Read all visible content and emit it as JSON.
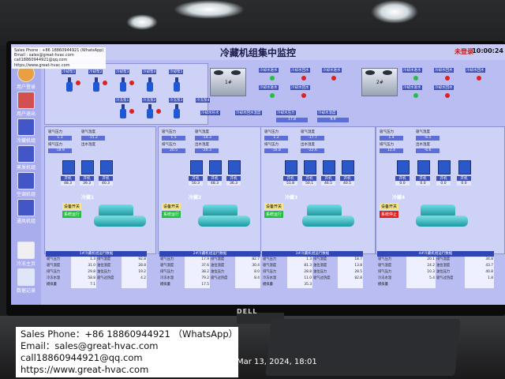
{
  "screen": {
    "title": "冷藏机组集中监控",
    "login_status": "未登录",
    "time": "10:00:24"
  },
  "sidebar": [
    {
      "label": "用户登录"
    },
    {
      "label": "用户退出"
    },
    {
      "label": "冷藏机组"
    },
    {
      "label": "蒸发机组"
    },
    {
      "label": "空调机组"
    },
    {
      "label": "通风机组"
    },
    {
      "label": "冷冻主页"
    },
    {
      "label": "数据记录"
    }
  ],
  "pumps": {
    "labels": [
      "冷却泵1",
      "冷却泵2",
      "冷却泵3",
      "冷却泵4",
      "冷却泵5"
    ],
    "labels2": [
      "冷冻泵1",
      "冷冻泵2",
      "冷冻泵3",
      "冷冻泵4"
    ]
  },
  "towers": [
    {
      "label": "1#"
    },
    {
      "label": "2#"
    }
  ],
  "tower_status": [
    [
      "冷却水进水",
      "冷却水回水"
    ],
    [
      "冷却水进水",
      "冷却水回水"
    ],
    [
      "冷却水进水",
      "冷却水回水"
    ]
  ],
  "system": {
    "items": [
      {
        "label": "冷却水补水",
        "value": "1.2"
      },
      {
        "label": "冷却水回水温度",
        "value": ""
      },
      {
        "label": "冷却水压力",
        "value": "17.8"
      },
      {
        "label": "冷却水温度",
        "value": "9.9"
      }
    ]
  },
  "units": [
    {
      "name": "冷藏1",
      "status_label": "设备开关",
      "status_text": "系统运行",
      "status_color": "#22c040",
      "params": [
        [
          "吸气压力",
          "1.3"
        ],
        [
          "吸气温度",
          "-15.2"
        ],
        [
          "排气压力",
          "-18.9"
        ],
        [
          "出水温度",
          ""
        ]
      ],
      "compressors": [
        "开机",
        "开机",
        "开机"
      ],
      "rt": [
        [
          "开机",
          "48.3"
        ],
        [
          "开机",
          "39.3"
        ],
        [
          "开机",
          "40.3"
        ]
      ]
    },
    {
      "name": "冷藏2",
      "status_label": "设备开关",
      "status_text": "系统运行",
      "status_color": "#22c040",
      "params": [
        [
          "吸气压力",
          "1.5"
        ],
        [
          "吸气温度",
          "-14.3"
        ],
        [
          "排气压力",
          "20.5"
        ],
        [
          "出水温度",
          "-20.3"
        ]
      ],
      "compressors": [
        "开机",
        "开机",
        "开机"
      ],
      "rt": [
        [
          "开机",
          "50.3"
        ],
        [
          "开机",
          "48.3"
        ],
        [
          "开机",
          "36.3"
        ]
      ]
    },
    {
      "name": "冷藏3",
      "status_label": "设备开关",
      "status_text": "系统运行",
      "status_color": "#22c040",
      "params": [
        [
          "吸气压力",
          "1.2"
        ],
        [
          "吸气温度",
          "-17.7"
        ],
        [
          "排气压力",
          "-16.8"
        ],
        [
          "出水温度",
          "-22.6"
        ]
      ],
      "compressors": [
        "开机",
        "开机",
        "开机",
        "开机"
      ],
      "rt": [
        [
          "开机",
          "51.8"
        ],
        [
          "开机",
          "50.1"
        ],
        [
          "开机",
          "46.5"
        ],
        [
          "开机",
          "40.5"
        ]
      ]
    },
    {
      "name": "冷藏4",
      "status_label": "设备开关",
      "status_text": "系统停止",
      "status_color": "#e02020",
      "params": [
        [
          "吸气压力",
          "1.4"
        ],
        [
          "吸气温度",
          "-6.5"
        ],
        [
          "排气压力",
          "12.4"
        ],
        [
          "出水温度",
          "-6.6"
        ]
      ],
      "compressors": [
        "关机",
        "关机",
        "关机",
        "关机"
      ],
      "rt": [
        [
          "开机",
          "0.0"
        ],
        [
          "开机",
          "0.0"
        ],
        [
          "开机",
          "0.0"
        ],
        [
          "开机",
          "0.0"
        ]
      ]
    }
  ],
  "tables": [
    {
      "title": "1#冷藏机组运行数据",
      "rows": [
        [
          "吸气压力",
          "1.3",
          "排气温度",
          "92.8"
        ],
        [
          "吸气温度",
          "31.0",
          "油位温度",
          "28.8"
        ],
        [
          "排气压力",
          "29.8",
          "油位压力",
          "19.2"
        ],
        [
          "冷冻水温",
          "58.8",
          "吸气过热度",
          "4.2"
        ],
        [
          "模拟量",
          "7.1",
          "",
          ""
        ]
      ]
    },
    {
      "title": "2#冷藏机组运行数据",
      "rows": [
        [
          "吸气压力",
          "17.9",
          "排气温度",
          "82.7"
        ],
        [
          "吸气温度",
          "37.6",
          "油位温度",
          "30.4"
        ],
        [
          "排气压力",
          "38.2",
          "油位压力",
          "8.0"
        ],
        [
          "冷冻水温",
          "79.2",
          "吸气过热度",
          "8.4"
        ],
        [
          "模拟量",
          "17.5",
          "",
          ""
        ]
      ]
    },
    {
      "title": "3#冷藏机组运行数据",
      "rows": [
        [
          "吸气压力",
          "1.3",
          "排气温度",
          "18.7"
        ],
        [
          "吸气温度",
          "81.3",
          "油位温度",
          "13.8"
        ],
        [
          "排气压力",
          "28.8",
          "油位压力",
          "28.5"
        ],
        [
          "冷冻水温",
          "11.0",
          "吸气过热度",
          "82.8"
        ],
        [
          "模拟量",
          "35.3",
          "",
          ""
        ]
      ]
    },
    {
      "title": "4#冷藏机组运行数据",
      "rows": [
        [
          "吸气压力",
          "20.1",
          "排气温度",
          "34.8"
        ],
        [
          "吸气温度",
          "24.2",
          "油位温度",
          "43.7"
        ],
        [
          "排气压力",
          "10.3",
          "油位压力",
          "40.8"
        ],
        [
          "冷冻水温",
          "5.4",
          "吸气过热度",
          "1.8"
        ],
        [
          "模拟量",
          "",
          "",
          ""
        ]
      ]
    }
  ],
  "device_brand": "DELL",
  "watermark_top": {
    "line1": "Sales Phone : +86 18860944921  (WhatsApp)",
    "line2": "Email : sales@great-hvac.com",
    "line3": "call18860944921@qq.com",
    "line4": "https://www.great-hvac.com"
  },
  "watermark_bottom": {
    "line1": "Sales Phone：+86 18860944921 （WhatsApp）",
    "line2": "Email：sales@great-hvac.com",
    "line3": "call18860944921@qq.com",
    "line4": "https://www.great-hvac.com"
  },
  "timestamp": "Mar 13, 2024, 18:01"
}
